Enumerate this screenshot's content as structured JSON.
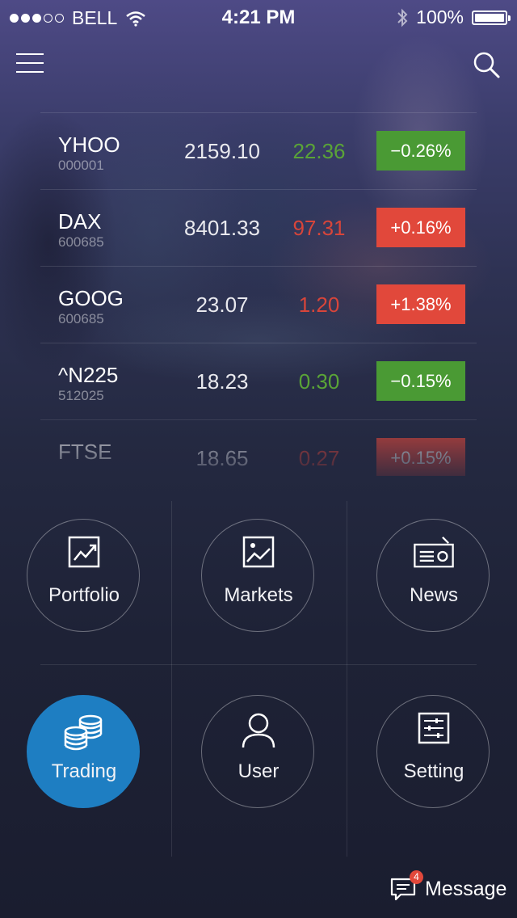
{
  "status_bar": {
    "carrier": "BELL",
    "time": "4:21 PM",
    "battery": "100%",
    "signal_bars_filled": 3,
    "signal_bars_total": 5
  },
  "header": {
    "menu_icon": "hamburger-icon",
    "search_icon": "search-icon"
  },
  "stocks": [
    {
      "symbol": "YHOO",
      "code": "000001",
      "price": "2159.10",
      "change": "22.36",
      "percent": "−0.26%",
      "trend": "up"
    },
    {
      "symbol": "DAX",
      "code": "600685",
      "price": "8401.33",
      "change": "97.31",
      "percent": "+0.16%",
      "trend": "down"
    },
    {
      "symbol": "GOOG",
      "code": "600685",
      "price": "23.07",
      "change": "1.20",
      "percent": "+1.38%",
      "trend": "down"
    },
    {
      "symbol": "^N225",
      "code": "512025",
      "price": "18.23",
      "change": "0.30",
      "percent": "−0.15%",
      "trend": "up"
    },
    {
      "symbol": "FTSE",
      "code": "",
      "price": "18.65",
      "change": "0.27",
      "percent": "+0.15%",
      "trend": "down"
    }
  ],
  "menu": {
    "portfolio": {
      "label": "Portfolio",
      "icon": "portfolio-chart-icon"
    },
    "markets": {
      "label": "Markets",
      "icon": "markets-image-icon"
    },
    "news": {
      "label": "News",
      "icon": "radio-icon"
    },
    "trading": {
      "label": "Trading",
      "icon": "coins-icon"
    },
    "user": {
      "label": "User",
      "icon": "user-icon"
    },
    "setting": {
      "label": "Setting",
      "icon": "sliders-icon"
    }
  },
  "message": {
    "label": "Message",
    "badge": "4",
    "icon": "chat-bubble-icon"
  },
  "colors": {
    "up": "#4a9a34",
    "down": "#e1483b",
    "active": "#1e7ec2"
  }
}
